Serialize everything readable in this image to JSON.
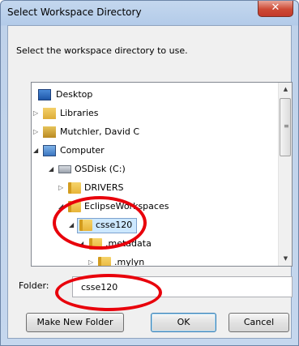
{
  "window": {
    "title": "Select Workspace Directory",
    "close_glyph": "✕"
  },
  "instruction": "Select the workspace directory to use.",
  "tree": {
    "items": [
      {
        "label": "Desktop",
        "icon": "desktop-icon",
        "expander": ""
      },
      {
        "label": "Libraries",
        "icon": "libraries-icon",
        "expander": "▷"
      },
      {
        "label": "Mutchler, David C",
        "icon": "user-folder-icon",
        "expander": "▷"
      },
      {
        "label": "Computer",
        "icon": "computer-icon",
        "expander": "◢"
      },
      {
        "label": "OSDisk (C:)",
        "icon": "disk-drive-icon",
        "expander": "◢"
      },
      {
        "label": "DRIVERS",
        "icon": "folder-icon",
        "expander": "▷"
      },
      {
        "label": "EclipseWorkspaces",
        "icon": "folder-icon",
        "expander": "◢"
      },
      {
        "label": "csse120",
        "icon": "folder-icon",
        "expander": "◢",
        "selected": true
      },
      {
        "label": ".metadata",
        "icon": "folder-icon",
        "expander": "◢"
      },
      {
        "label": ".mylyn",
        "icon": "folder-icon",
        "expander": "▷"
      }
    ],
    "scroll_up": "▲",
    "scroll_down": "▼",
    "scroll_grip": "≡"
  },
  "folder_field": {
    "label": "Folder:",
    "value": "csse120"
  },
  "buttons": {
    "make_new_folder": "Make New Folder",
    "ok": "OK",
    "cancel": "Cancel"
  },
  "colors": {
    "annotation": "#e8000b",
    "selection": "#cde8ff",
    "title_bar": "#c4d7ee"
  }
}
